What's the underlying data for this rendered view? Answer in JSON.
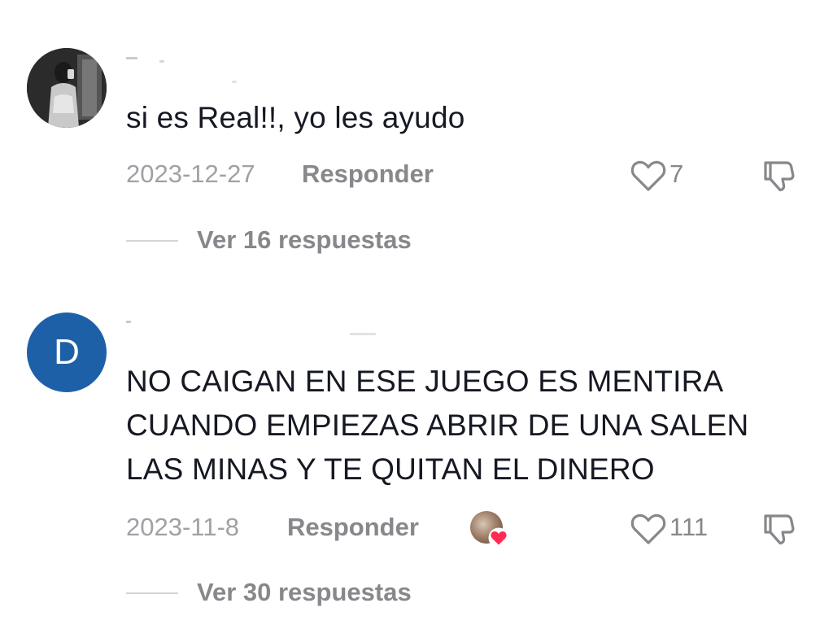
{
  "comments": [
    {
      "avatar_icon": "user-photo",
      "text": "si es Real!!, yo les ayudo",
      "date": "2023-12-27",
      "reply_label": "Responder",
      "likes": "7",
      "view_replies": "Ver 16 respuestas"
    },
    {
      "avatar_letter": "D",
      "avatar_color": "#1e60a8",
      "text": "NO CAIGAN EN ESE JUEGO ES MENTIRA\nCUANDO EMPIEZAS ABRIR DE UNA SALEN\nLAS MINAS Y TE QUITAN EL DINERO",
      "date": "2023-11-8",
      "reply_label": "Responder",
      "creator_liked": true,
      "likes": "111",
      "view_replies": "Ver 30 respuestas"
    }
  ],
  "colors": {
    "text": "#161823",
    "muted": "#87878c",
    "date": "#a0a0a6",
    "heart_accent": "#fe2c55"
  }
}
